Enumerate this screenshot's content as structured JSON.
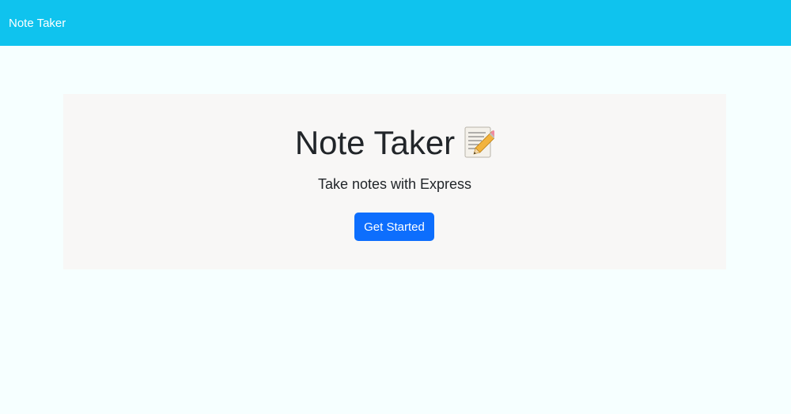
{
  "navbar": {
    "brand": "Note Taker",
    "background_color": "#0fc3ee"
  },
  "hero": {
    "title": "Note Taker",
    "title_icon": "memo-icon",
    "subtitle": "Take notes with Express",
    "cta_label": "Get Started",
    "cta_color": "#0d6efd"
  }
}
